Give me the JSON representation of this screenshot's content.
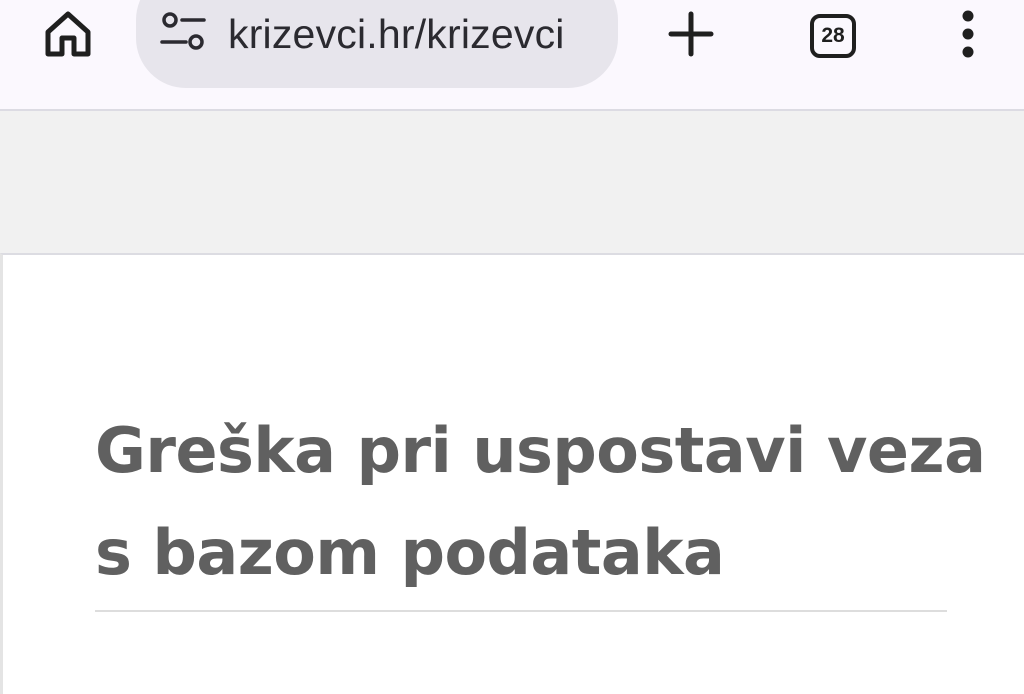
{
  "browser": {
    "url": "krizevci.hr/krizevci",
    "tab_count": "28",
    "icons": {
      "home": "home-icon",
      "site_settings": "tune-icon",
      "new_tab": "plus-icon",
      "tab_switcher": "tab-switcher-icon",
      "menu": "more-vert-icon"
    }
  },
  "page": {
    "error_title": "Greška pri uspostavi veza s bazom podataka"
  }
}
